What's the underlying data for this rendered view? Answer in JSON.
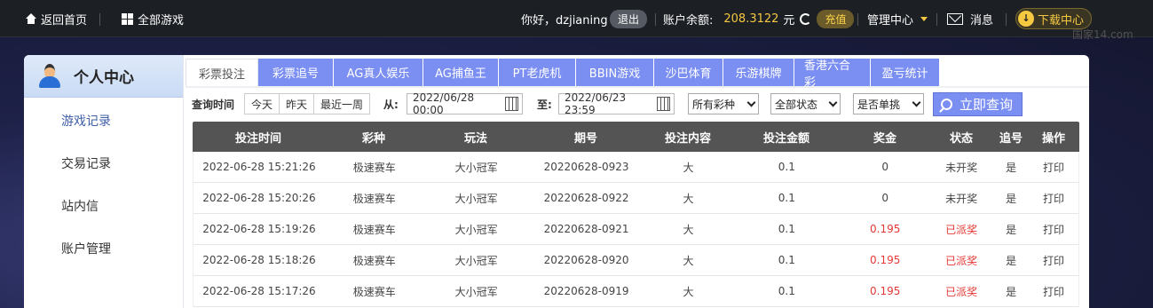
{
  "topbar": {
    "home": "返回首页",
    "all_games": "全部游戏",
    "greeting": "你好，dzjianing",
    "logout": "退出",
    "balance_label": "账户余额:",
    "balance_value": "208.3122",
    "balance_unit": "元",
    "recharge": "充值",
    "manage": "管理中心",
    "messages": "消息",
    "download": "下载中心",
    "watermark": "国家14.com"
  },
  "sidebar": {
    "title": "个人中心",
    "items": [
      "游戏记录",
      "交易记录",
      "站内信",
      "账户管理"
    ]
  },
  "tabs": [
    "彩票投注",
    "彩票追号",
    "AG真人娱乐",
    "AG捕鱼王",
    "PT老虎机",
    "BBIN游戏",
    "沙巴体育",
    "乐游棋牌",
    "香港六合彩",
    "盈亏统计"
  ],
  "filter": {
    "label": "查询时间",
    "quick": [
      "今天",
      "昨天",
      "最近一周"
    ],
    "from_label": "从:",
    "from_value": "2022/06/28 00:00",
    "to_label": "至:",
    "to_value": "2022/06/23 23:59",
    "lottery_select": "所有彩种",
    "status_select": "全部状态",
    "single_select": "是否单挑",
    "query_button": "立即查询"
  },
  "table": {
    "headers": [
      "投注时间",
      "彩种",
      "玩法",
      "期号",
      "投注内容",
      "投注金额",
      "奖金",
      "状态",
      "追号",
      "操作"
    ],
    "rows": [
      [
        "2022-06-28 15:21:26",
        "极速赛车",
        "大小冠军",
        "20220628-0923",
        "大",
        "0.1",
        "0",
        "未开奖",
        "是",
        "打印"
      ],
      [
        "2022-06-28 15:20:26",
        "极速赛车",
        "大小冠军",
        "20220628-0922",
        "大",
        "0.1",
        "0",
        "未开奖",
        "是",
        "打印"
      ],
      [
        "2022-06-28 15:19:26",
        "极速赛车",
        "大小冠军",
        "20220628-0921",
        "大",
        "0.1",
        "0.195",
        "已派奖",
        "是",
        "打印"
      ],
      [
        "2022-06-28 15:18:26",
        "极速赛车",
        "大小冠军",
        "20220628-0920",
        "大",
        "0.1",
        "0.195",
        "已派奖",
        "是",
        "打印"
      ],
      [
        "2022-06-28 15:17:26",
        "极速赛车",
        "大小冠军",
        "20220628-0919",
        "大",
        "0.1",
        "0.195",
        "已派奖",
        "是",
        "打印"
      ]
    ]
  }
}
